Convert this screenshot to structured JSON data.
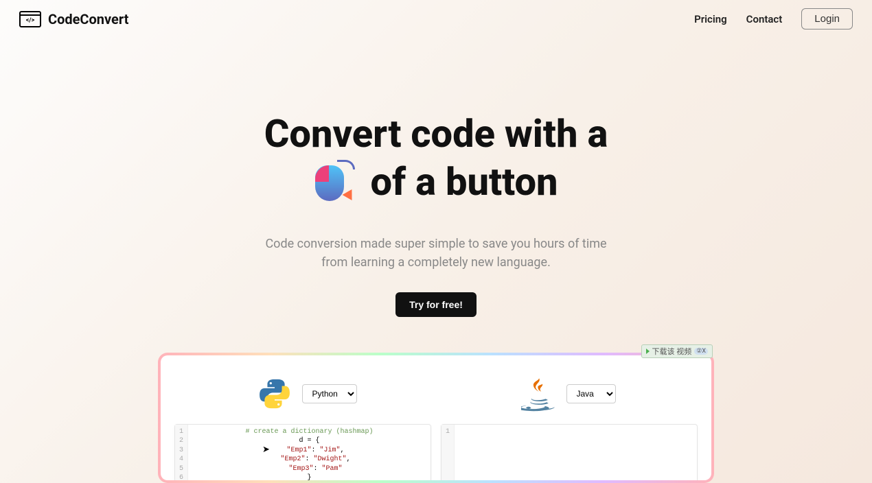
{
  "brand": "CodeConvert",
  "nav": {
    "pricing": "Pricing",
    "contact": "Contact",
    "login": "Login"
  },
  "hero": {
    "line1": "Convert code with a",
    "line2_tail": "of a button",
    "subtitle_l1": "Code conversion made super simple to save you hours of time",
    "subtitle_l2": "from learning a completely new language.",
    "cta": "Try for free!"
  },
  "demo": {
    "from_lang": "Python",
    "to_lang": "Java",
    "code": {
      "gutter": [
        "1",
        "2",
        "3",
        "4",
        "5",
        "6"
      ],
      "comment": "# create a dictionary (hashmap)",
      "l2": "d = {",
      "l3_key": "\"Emp1\"",
      "l3_val": "\"Jim\"",
      "l4_key": "\"Emp2\"",
      "l4_val": "\"Dwight\"",
      "l5_key": "\"Emp3\"",
      "l5_val": "\"Pam\"",
      "l6": "}"
    },
    "right_gutter": [
      "1"
    ]
  },
  "badge": {
    "text": "下载该 视频",
    "close": "②X"
  }
}
